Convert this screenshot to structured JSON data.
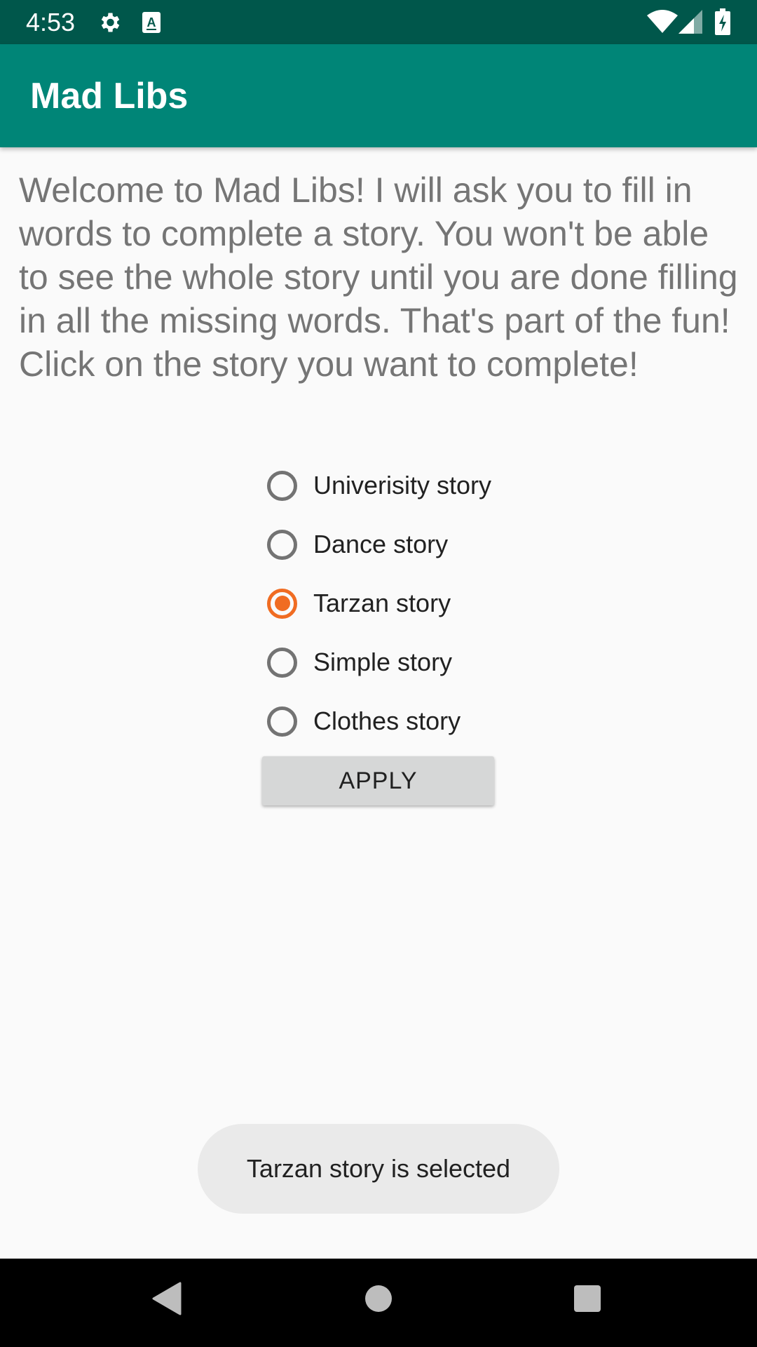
{
  "status_bar": {
    "time": "4:53",
    "icons": [
      "settings-icon",
      "keyboard-a-icon",
      "wifi-icon",
      "signal-icon",
      "battery-charging-icon"
    ]
  },
  "app_bar": {
    "title": "Mad Libs"
  },
  "intro": {
    "text": "Welcome to Mad Libs! I will ask you to fill in words to complete a story. You won't be able to see the whole story until you are done filling in all the missing words. That's part of the fun! Click on the story you want to complete!"
  },
  "stories": {
    "options": [
      {
        "label": "Univerisity story",
        "checked": false
      },
      {
        "label": "Dance story",
        "checked": false
      },
      {
        "label": "Tarzan story",
        "checked": true
      },
      {
        "label": "Simple story",
        "checked": false
      },
      {
        "label": "Clothes story",
        "checked": false
      }
    ],
    "apply_label": "APPLY"
  },
  "toast": {
    "text": "Tarzan story is selected"
  },
  "nav_bar": {
    "icons": [
      "back-icon",
      "home-icon",
      "recents-icon"
    ]
  },
  "colors": {
    "status_bar": "#00574b",
    "app_bar": "#008577",
    "accent": "#f06c22",
    "intro_text": "#757575",
    "button": "#d6d7d7"
  }
}
